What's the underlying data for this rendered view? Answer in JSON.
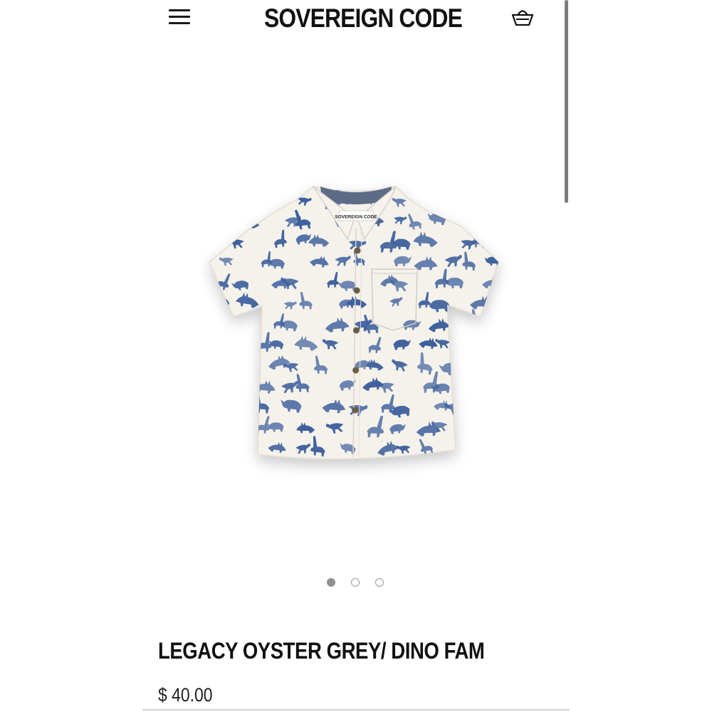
{
  "header": {
    "brand": "SOVEREIGN CODE",
    "menu_icon": "hamburger-menu-icon",
    "cart_icon": "shopping-basket-icon"
  },
  "product": {
    "title": "LEGACY OYSTER GREY/ DINO FAM",
    "price": "$ 40.00",
    "image": {
      "label_text": "SOVEREIGN CODE",
      "description_icon": "dinosaur-print-shirt-image"
    },
    "carousel": {
      "count": 3,
      "active_index": 0
    }
  },
  "colors": {
    "text": "#111111",
    "print_blue": "#3d5f9c",
    "shirt_white": "#f4f1ea",
    "dot_active": "#8f8f8f"
  }
}
